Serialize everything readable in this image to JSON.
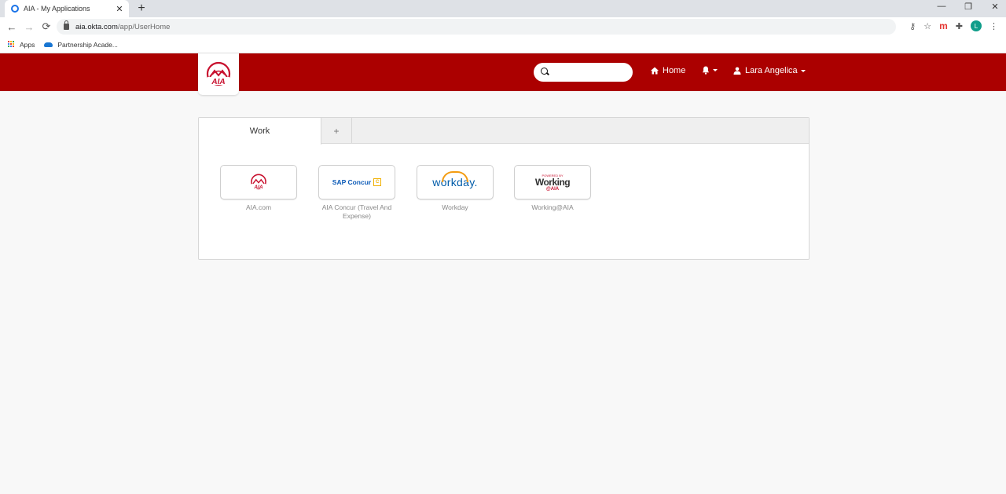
{
  "browser": {
    "tab_title": "AIA - My Applications",
    "url_domain": "aia.okta.com",
    "url_path": "/app/UserHome",
    "profile_initial": "L",
    "bookmarks": [
      {
        "label": "Apps"
      },
      {
        "label": "Partnership Acade..."
      }
    ]
  },
  "header": {
    "logo_text": "AIA",
    "search_placeholder": "",
    "home_label": "Home",
    "user_name": "Lara Angelica",
    "accent_color": "#ab0000"
  },
  "dashboard": {
    "tabs": [
      {
        "label": "Work"
      },
      {
        "label": "+"
      }
    ],
    "apps": [
      {
        "label": "AIA.com",
        "logo": "aia-logo"
      },
      {
        "label": "AIA Concur (Travel And Expense)",
        "logo": "sap-concur-logo",
        "logo_text": "SAP Concur",
        "logo_mark": "C"
      },
      {
        "label": "Workday",
        "logo": "workday-logo",
        "logo_text": "workday."
      },
      {
        "label": "Working@AIA",
        "logo": "working-aia-logo",
        "logo_text": "Working",
        "logo_sub": "@AIA",
        "logo_top": "POWERED BY"
      }
    ]
  }
}
